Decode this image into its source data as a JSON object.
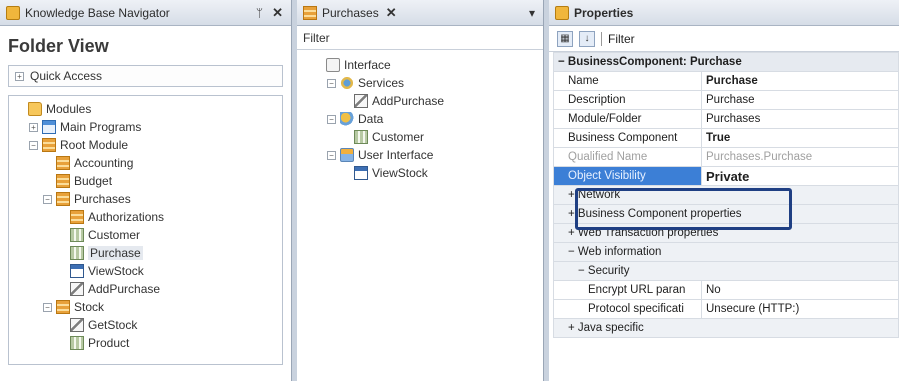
{
  "kb_panel": {
    "title": "Knowledge Base Navigator",
    "pin_glyph": "ᛘ",
    "close_glyph": "✕",
    "heading": "Folder View",
    "quick_access": "Quick Access",
    "tree": [
      {
        "label": "Modules",
        "icon": "modules-icon",
        "exp": ""
      },
      {
        "label": "Main Programs",
        "icon": "main-programs-icon",
        "exp": "+"
      },
      {
        "label": "Root Module",
        "icon": "root-module-icon",
        "exp": "−"
      },
      {
        "label": "Accounting",
        "icon": "module-icon",
        "exp": ""
      },
      {
        "label": "Budget",
        "icon": "module-icon",
        "exp": ""
      },
      {
        "label": "Purchases",
        "icon": "module-icon",
        "exp": "−"
      },
      {
        "label": "Authorizations",
        "icon": "module-icon",
        "exp": ""
      },
      {
        "label": "Customer",
        "icon": "transaction-icon",
        "exp": ""
      },
      {
        "label": "Purchase",
        "icon": "transaction-icon",
        "exp": "",
        "selected": true
      },
      {
        "label": "ViewStock",
        "icon": "webpanel-icon",
        "exp": ""
      },
      {
        "label": "AddPurchase",
        "icon": "procedure-icon",
        "exp": ""
      },
      {
        "label": "Stock",
        "icon": "module-icon",
        "exp": "−"
      },
      {
        "label": "GetStock",
        "icon": "procedure-icon",
        "exp": ""
      },
      {
        "label": "Product",
        "icon": "transaction-icon",
        "exp": ""
      }
    ]
  },
  "purchases_panel": {
    "tab_label": "Purchases",
    "close_glyph": "✕",
    "dropdown_glyph": "▾",
    "filter_label": "Filter",
    "tree": [
      {
        "label": "Interface",
        "icon": "interface-icon",
        "exp": ""
      },
      {
        "label": "Services",
        "icon": "services-icon",
        "exp": "−"
      },
      {
        "label": "AddPurchase",
        "icon": "procedure-icon",
        "exp": ""
      },
      {
        "label": "Data",
        "icon": "data-icon",
        "exp": "−"
      },
      {
        "label": "Customer",
        "icon": "transaction-icon",
        "exp": ""
      },
      {
        "label": "User Interface",
        "icon": "user-interface-icon",
        "exp": "−"
      },
      {
        "label": "ViewStock",
        "icon": "webpanel-icon",
        "exp": ""
      }
    ]
  },
  "properties_panel": {
    "title": "Properties",
    "filter_label": "Filter",
    "category_header": "BusinessComponent: Purchase",
    "rows": [
      {
        "name": "Name",
        "value": "Purchase",
        "bold": true
      },
      {
        "name": "Description",
        "value": "Purchase"
      },
      {
        "name": "Module/Folder",
        "value": "Purchases"
      },
      {
        "name": "Business Component",
        "value": "True",
        "bold": true
      },
      {
        "name": "Qualified Name",
        "value": "Purchases.Purchase",
        "faded": true
      },
      {
        "name": "Object Visibility",
        "value": "Private",
        "highlight": true
      },
      {
        "name": "Network",
        "value": "",
        "group": true
      }
    ],
    "groups": [
      {
        "label": "Business Component properties",
        "exp": "+"
      },
      {
        "label": "Web Transaction properties",
        "exp": "+"
      },
      {
        "label": "Web information",
        "exp": "−"
      }
    ],
    "security": {
      "label": "Security",
      "rows": [
        {
          "name": "Encrypt URL paran",
          "value": "No"
        },
        {
          "name": "Protocol specificati",
          "value": "Unsecure (HTTP:)"
        }
      ]
    },
    "java_group": "Java specific"
  }
}
